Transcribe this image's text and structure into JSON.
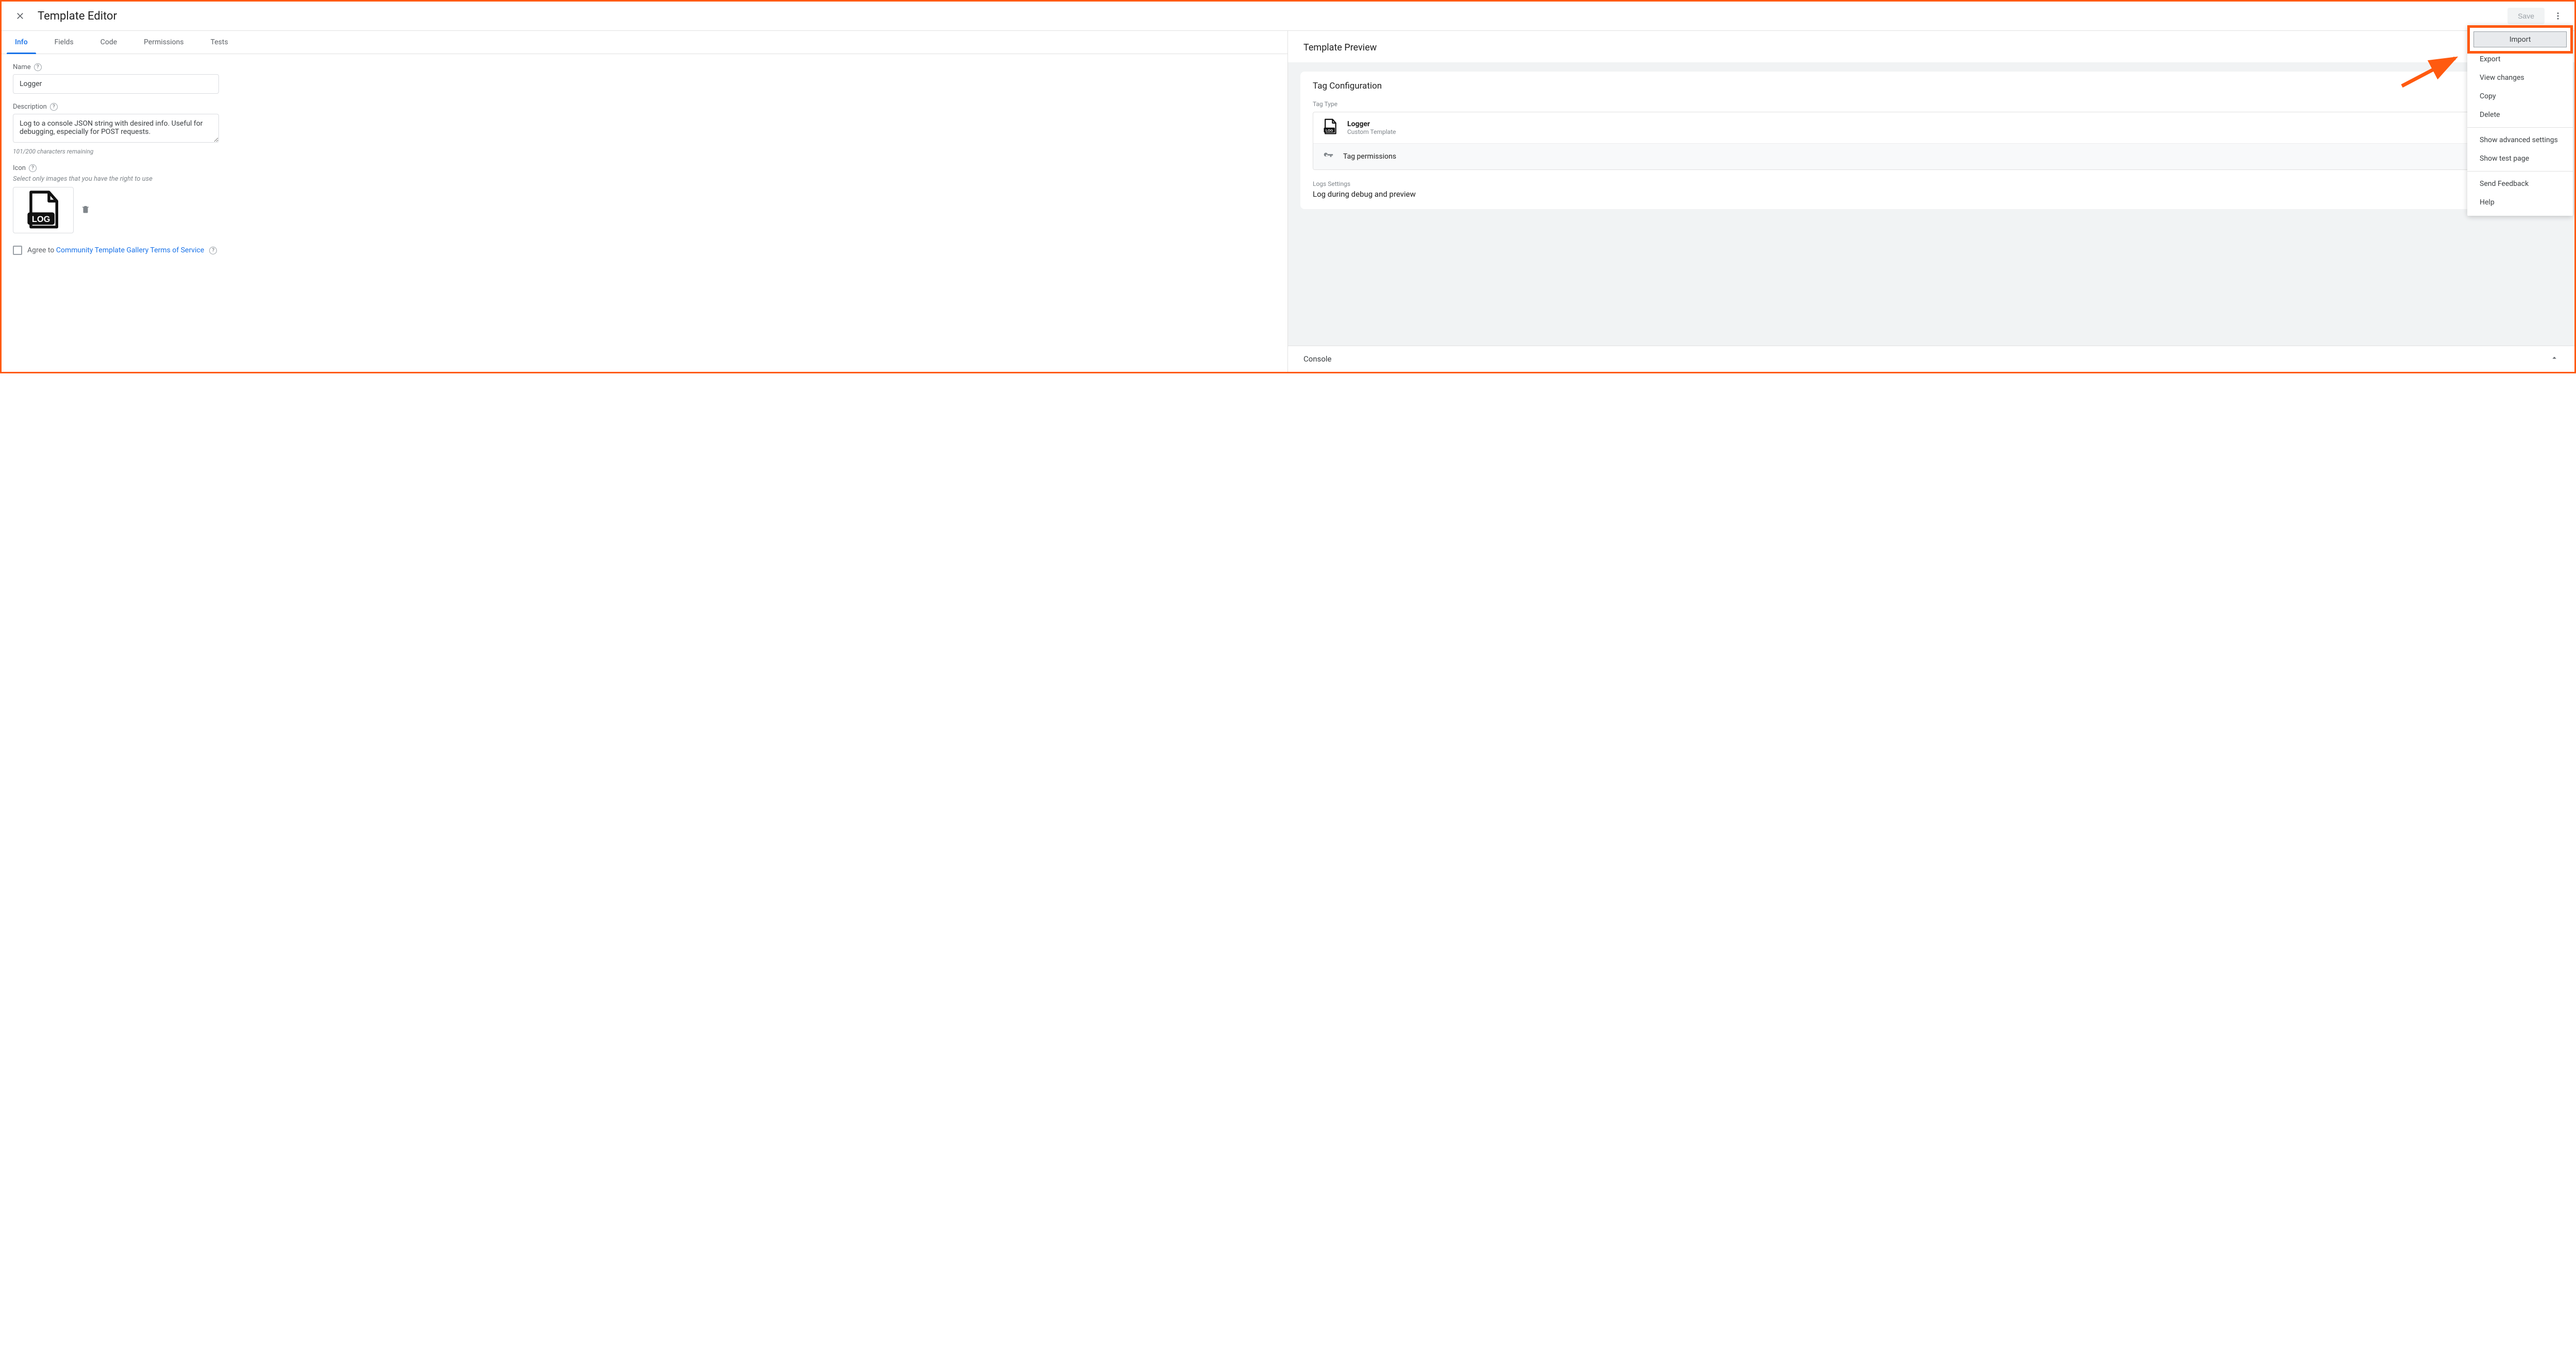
{
  "header": {
    "title": "Template Editor",
    "save_label": "Save"
  },
  "tabs": [
    {
      "label": "Info",
      "active": true
    },
    {
      "label": "Fields",
      "active": false
    },
    {
      "label": "Code",
      "active": false
    },
    {
      "label": "Permissions",
      "active": false
    },
    {
      "label": "Tests",
      "active": false
    }
  ],
  "form": {
    "name_label": "Name",
    "name_value": "Logger",
    "description_label": "Description",
    "description_value": "Log to a console JSON string with desired info. Useful for debugging, especially for POST requests.",
    "char_count": "101/200 characters remaining",
    "icon_label": "Icon",
    "icon_hint": "Select only images that you have the right to use",
    "agree_prefix": "Agree to ",
    "agree_link": "Community Template Gallery Terms of Service"
  },
  "preview": {
    "title": "Template Preview",
    "card_title": "Tag Configuration",
    "tag_type_label": "Tag Type",
    "tag_name": "Logger",
    "tag_sub": "Custom Template",
    "permissions_label": "Tag permissions",
    "logs_label": "Logs Settings",
    "logs_value": "Log during debug and preview"
  },
  "console": {
    "title": "Console"
  },
  "dropdown": {
    "import": "Import",
    "items_a": [
      "Export",
      "View changes",
      "Copy",
      "Delete"
    ],
    "items_b": [
      "Show advanced settings",
      "Show test page"
    ],
    "items_c": [
      "Send Feedback",
      "Help"
    ]
  }
}
